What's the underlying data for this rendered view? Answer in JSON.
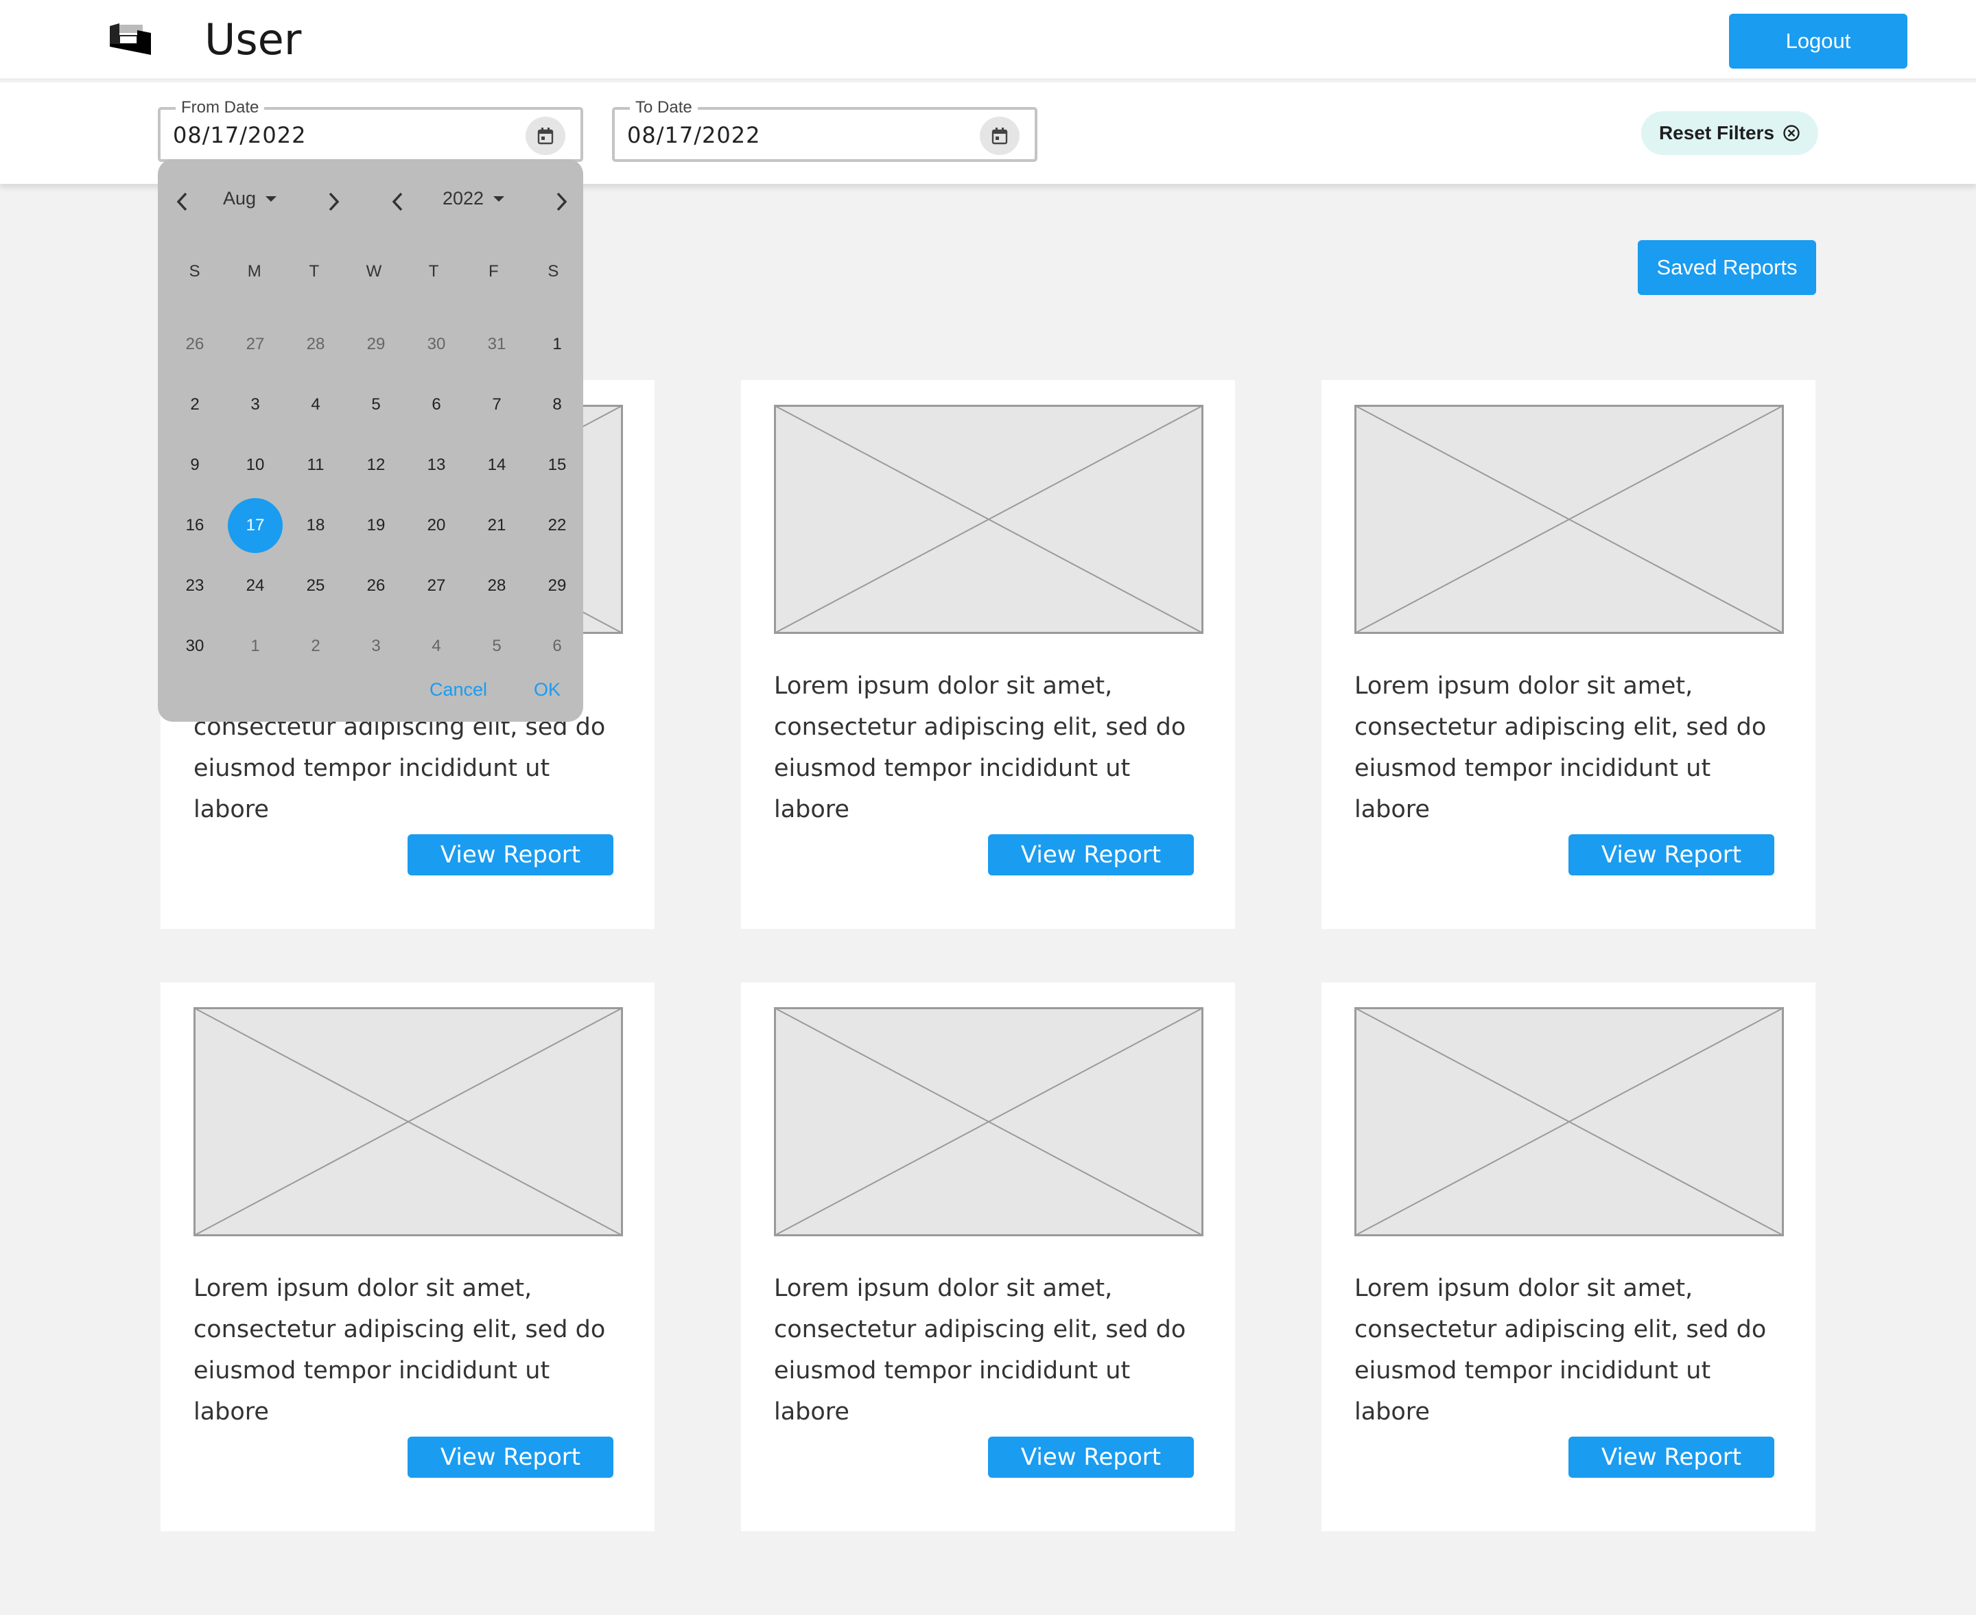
{
  "header": {
    "title": "User",
    "logout_label": "Logout"
  },
  "filters": {
    "from_label": "From Date",
    "from_value": "08/17/2022",
    "to_label": "To Date",
    "to_value": "08/17/2022",
    "reset_label": "Reset Filters"
  },
  "saved_reports_label": "Saved Reports",
  "datepicker": {
    "month": "Aug",
    "year": "2022",
    "weekdays": [
      "S",
      "M",
      "T",
      "W",
      "T",
      "F",
      "S"
    ],
    "days": [
      {
        "label": "26",
        "other": true
      },
      {
        "label": "27",
        "other": true
      },
      {
        "label": "28",
        "other": true
      },
      {
        "label": "29",
        "other": true
      },
      {
        "label": "30",
        "other": true
      },
      {
        "label": "31",
        "other": true
      },
      {
        "label": "1"
      },
      {
        "label": "2"
      },
      {
        "label": "3"
      },
      {
        "label": "4"
      },
      {
        "label": "5"
      },
      {
        "label": "6"
      },
      {
        "label": "7"
      },
      {
        "label": "8"
      },
      {
        "label": "9"
      },
      {
        "label": "10"
      },
      {
        "label": "11"
      },
      {
        "label": "12"
      },
      {
        "label": "13"
      },
      {
        "label": "14"
      },
      {
        "label": "15"
      },
      {
        "label": "16"
      },
      {
        "label": "17",
        "selected": true
      },
      {
        "label": "18"
      },
      {
        "label": "19"
      },
      {
        "label": "20"
      },
      {
        "label": "21"
      },
      {
        "label": "22"
      },
      {
        "label": "23"
      },
      {
        "label": "24"
      },
      {
        "label": "25"
      },
      {
        "label": "26"
      },
      {
        "label": "27"
      },
      {
        "label": "28"
      },
      {
        "label": "29"
      },
      {
        "label": "30"
      },
      {
        "label": "1",
        "other": true
      },
      {
        "label": "2",
        "other": true
      },
      {
        "label": "3",
        "other": true
      },
      {
        "label": "4",
        "other": true
      },
      {
        "label": "5",
        "other": true
      },
      {
        "label": "6",
        "other": true
      }
    ],
    "cancel_label": "Cancel",
    "ok_label": "OK"
  },
  "cards": [
    {
      "description": "Lorem ipsum dolor sit amet, consectetur adipiscing elit, sed do eiusmod tempor incididunt ut labore",
      "button_label": "View Report"
    },
    {
      "description": "Lorem ipsum dolor sit amet, consectetur adipiscing elit, sed do eiusmod tempor incididunt ut labore",
      "button_label": "View Report"
    },
    {
      "description": "Lorem ipsum dolor sit amet, consectetur adipiscing elit, sed do eiusmod tempor incididunt ut labore",
      "button_label": "View Report"
    },
    {
      "description": "Lorem ipsum dolor sit amet, consectetur adipiscing elit, sed do eiusmod tempor incididunt ut labore",
      "button_label": "View Report"
    },
    {
      "description": "Lorem ipsum dolor sit amet, consectetur adipiscing elit, sed do eiusmod tempor incididunt ut labore",
      "button_label": "View Report"
    },
    {
      "description": "Lorem ipsum dolor sit amet, consectetur adipiscing elit, sed do eiusmod tempor incididunt ut labore",
      "button_label": "View Report"
    }
  ],
  "colors": {
    "accent": "#1a9cf0",
    "page_background": "#f2f2f2",
    "picker_background": "#bdbdbd",
    "reset_chip": "#dff5f3"
  },
  "icons": {
    "logo": "app-logo-icon",
    "calendar": "calendar-icon",
    "reset": "circle-x-icon",
    "prev": "chevron-left-icon",
    "next": "chevron-right-icon",
    "dropdown": "caret-down-icon"
  }
}
